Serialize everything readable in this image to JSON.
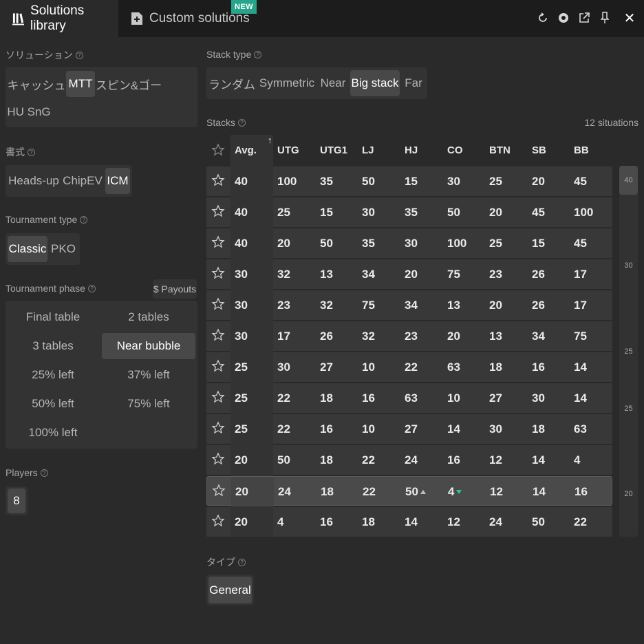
{
  "tabs": {
    "library_label": "Solutions library",
    "custom_label": "Custom solutions",
    "new_badge": "NEW"
  },
  "left": {
    "solution_label": "ソリューション",
    "solution_options": [
      "キャッシュ",
      "MTT",
      "スピン&ゴー",
      "HU SnG"
    ],
    "format_label": "書式",
    "format_options": [
      "Heads-up",
      "ChipEV",
      "ICM"
    ],
    "tournament_type_label": "Tournament type",
    "tournament_type_options": [
      "Classic",
      "PKO"
    ],
    "phase_label": "Tournament phase",
    "payouts_label": "$ Payouts",
    "phase_options": [
      "Final table",
      "2 tables",
      "3 tables",
      "Near bubble",
      "25% left",
      "37% left",
      "50% left",
      "75% left",
      "100% left"
    ],
    "players_label": "Players",
    "players_value": "8"
  },
  "right": {
    "stack_type_label": "Stack type",
    "stack_type_options": [
      "ランダム",
      "Symmetric",
      "Near",
      "Big stack",
      "Far"
    ],
    "stacks_label": "Stacks",
    "situations": "12 situations",
    "columns": [
      "Avg.",
      "UTG",
      "UTG1",
      "LJ",
      "HJ",
      "CO",
      "BTN",
      "SB",
      "BB"
    ],
    "rows": [
      [
        "40",
        "100",
        "35",
        "50",
        "15",
        "30",
        "25",
        "20",
        "45"
      ],
      [
        "40",
        "25",
        "15",
        "30",
        "35",
        "50",
        "20",
        "45",
        "100"
      ],
      [
        "40",
        "20",
        "50",
        "35",
        "30",
        "100",
        "25",
        "15",
        "45"
      ],
      [
        "30",
        "32",
        "13",
        "34",
        "20",
        "75",
        "23",
        "26",
        "17"
      ],
      [
        "30",
        "23",
        "32",
        "75",
        "34",
        "13",
        "20",
        "26",
        "17"
      ],
      [
        "30",
        "17",
        "26",
        "32",
        "23",
        "20",
        "13",
        "34",
        "75"
      ],
      [
        "25",
        "30",
        "27",
        "10",
        "22",
        "63",
        "18",
        "16",
        "14"
      ],
      [
        "25",
        "22",
        "18",
        "16",
        "63",
        "10",
        "27",
        "30",
        "14"
      ],
      [
        "25",
        "22",
        "16",
        "10",
        "27",
        "14",
        "30",
        "18",
        "63"
      ],
      [
        "20",
        "50",
        "18",
        "22",
        "24",
        "16",
        "12",
        "14",
        "4"
      ],
      [
        "20",
        "24",
        "18",
        "22",
        "50",
        "4",
        "12",
        "14",
        "16"
      ],
      [
        "20",
        "4",
        "16",
        "18",
        "14",
        "12",
        "24",
        "50",
        "22"
      ]
    ],
    "scroll_labels": [
      "40",
      "30",
      "25",
      "25",
      "20"
    ],
    "type_label": "タイプ",
    "type_options": [
      "General"
    ]
  }
}
